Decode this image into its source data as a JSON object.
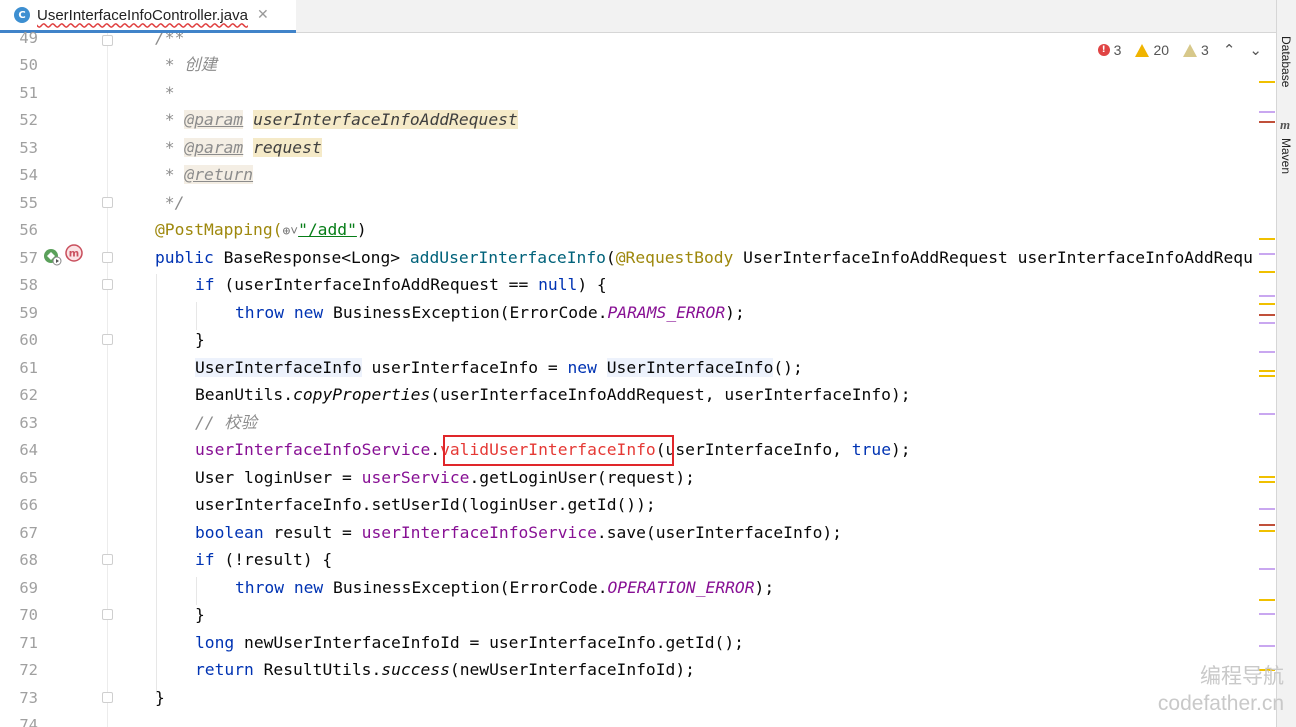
{
  "tab": {
    "icon": "C",
    "label": "UserInterfaceInfoController.java",
    "close": "✕"
  },
  "inspections": {
    "errors": "3",
    "warnings": "20",
    "weak_warnings": "3",
    "up": "⌃",
    "down": "⌄"
  },
  "sidebar": {
    "database": "Database",
    "maven": "Maven",
    "maven_icon": "m"
  },
  "line_numbers": [
    "49",
    "50",
    "51",
    "52",
    "53",
    "54",
    "55",
    "56",
    "57",
    "58",
    "59",
    "60",
    "61",
    "62",
    "63",
    "64",
    "65",
    "66",
    "67",
    "68",
    "69",
    "70",
    "71",
    "72",
    "73",
    "74"
  ],
  "gutter_icons": [
    "run-bean-icon",
    "mapping-icon"
  ],
  "code": {
    "l49": "/**",
    "l50": " * 创建",
    "l51": " *",
    "l52_star": " * ",
    "l52_tag": "@param",
    "l52_name": "userInterfaceInfoAddRequest",
    "l53_star": " * ",
    "l53_tag": "@param",
    "l53_name": "request",
    "l54_star": " * ",
    "l54_tag": "@return",
    "l55": " */",
    "l56_ann": "@PostMapping(",
    "l56_icon": "⊕˅",
    "l56_str": "\"/add\"",
    "l56_end": ")",
    "l57_kw": "public",
    "l57_a": " BaseResponse<Long> ",
    "l57_m": "addUserInterfaceInfo",
    "l57_b": "(",
    "l57_ann": "@RequestBody",
    "l57_c": " UserInterfaceInfoAddRequest userInterfaceInfoAddRequ",
    "l58_kw": "if",
    "l58_a": " (userInterfaceInfoAddRequest == ",
    "l58_null": "null",
    "l58_b": ") {",
    "l59_kw": "throw new",
    "l59_a": " BusinessException(ErrorCode.",
    "l59_c": "PARAMS_ERROR",
    "l59_b": ");",
    "l60": "}",
    "l61_t": "UserInterfaceInfo",
    "l61_a": " userInterfaceInfo = ",
    "l61_kw": "new",
    "l61_sp": " ",
    "l61_t2": "UserInterfaceInfo",
    "l61_b": "();",
    "l62_a": "BeanUtils.",
    "l62_m": "copyProperties",
    "l62_b": "(userInterfaceInfoAddRequest, userInterfaceInfo);",
    "l63": "// 校验",
    "l64_f": "userInterfaceInfoService",
    "l64_dot": ".",
    "l64_err": "validUserInterfaceInfo",
    "l64_a": "(userInterfaceInfo, ",
    "l64_kw": "true",
    "l64_b": ");",
    "l65_a": "User loginUser = ",
    "l65_f": "userService",
    "l65_b": ".getLoginUser(request);",
    "l66": "userInterfaceInfo.setUserId(loginUser.getId());",
    "l67_kw": "boolean",
    "l67_a": " result = ",
    "l67_f": "userInterfaceInfoService",
    "l67_b": ".save(userInterfaceInfo);",
    "l68_kw": "if",
    "l68_a": " (!result) {",
    "l69_kw": "throw new",
    "l69_a": " BusinessException(ErrorCode.",
    "l69_c": "OPERATION_ERROR",
    "l69_b": ");",
    "l70": "}",
    "l71_kw": "long",
    "l71_a": " newUserInterfaceInfoId = userInterfaceInfo.getId();",
    "l72_kw": "return",
    "l72_a": " ResultUtils.",
    "l72_m": "success",
    "l72_b": "(newUserInterfaceInfoId);",
    "l73": "}"
  },
  "watermark": {
    "line1": "编程导航",
    "line2": "codefather.cn"
  },
  "colors": {
    "accent": "#4083c9",
    "error_box": "#e0262a",
    "keyword": "#0033b3",
    "field": "#871094",
    "annotation": "#9e880d",
    "string": "#067d17"
  }
}
